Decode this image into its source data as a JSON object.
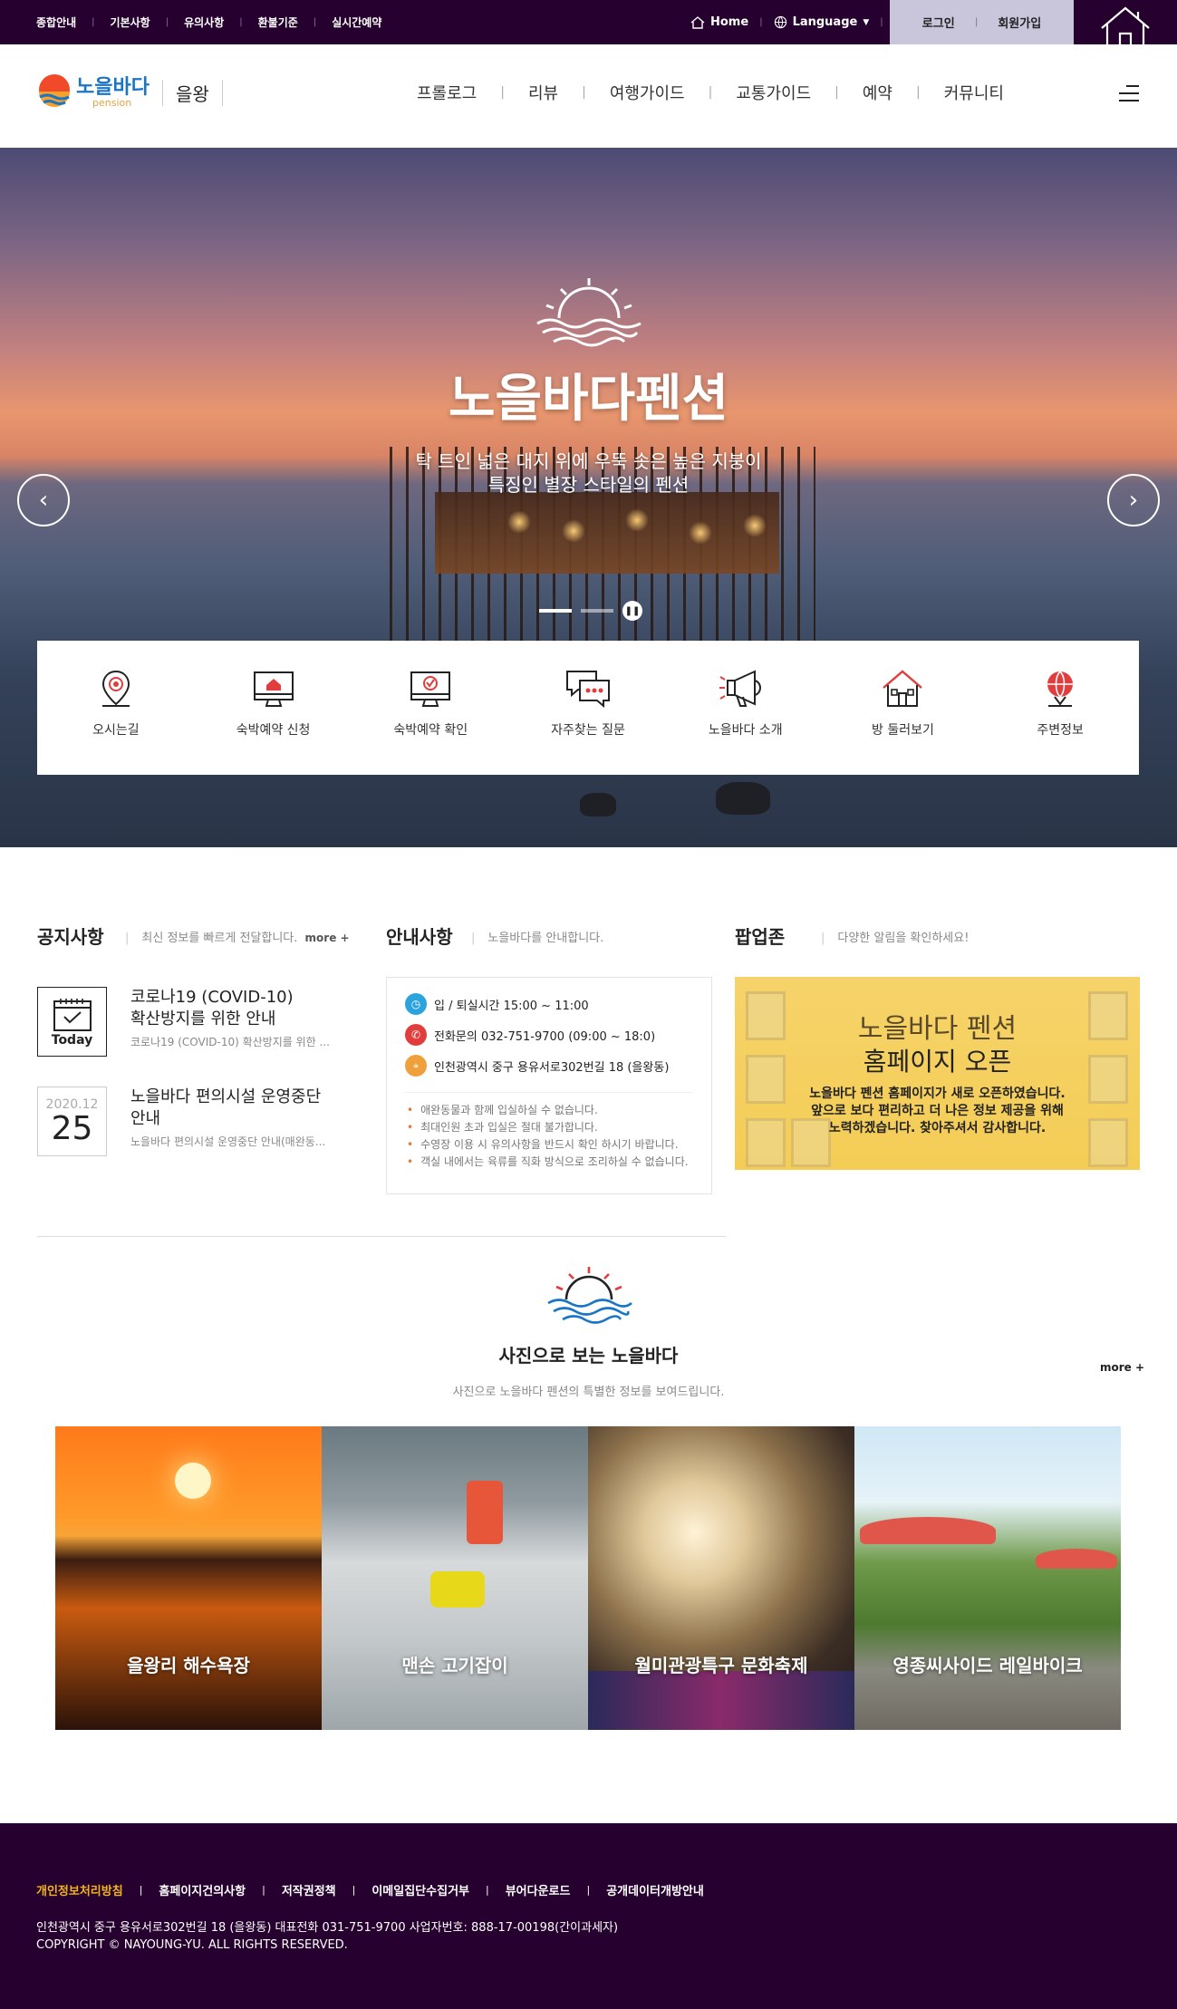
{
  "topbar": {
    "util_links": [
      "종합안내",
      "기본사항",
      "유의사항",
      "환불기준",
      "실시간예약"
    ],
    "home": "Home",
    "language": "Language",
    "login": "로그인",
    "signup": "회원가입"
  },
  "header": {
    "logo_main": "노을바다",
    "logo_sub": "pension",
    "region": "을왕",
    "menu": [
      "프롤로그",
      "리뷰",
      "여행가이드",
      "교통가이드",
      "예약",
      "커뮤니티"
    ]
  },
  "hero": {
    "title": "노을바다펜션",
    "subtitle_line1": "탁 트인 넓은 대지 위에  우뚝 솟은 높은 지붕이",
    "subtitle_line2": "특징인 별장 스타일의 펜션",
    "prev": "‹",
    "next": "›"
  },
  "quick_menu": [
    {
      "label": "오시는길",
      "icon": "map-pin-icon"
    },
    {
      "label": "숙박예약 신청",
      "icon": "monitor-house-icon"
    },
    {
      "label": "숙박예약 확인",
      "icon": "monitor-check-icon"
    },
    {
      "label": "자주찾는 질문",
      "icon": "chat-bubbles-icon"
    },
    {
      "label": "노을바다 소개",
      "icon": "megaphone-icon"
    },
    {
      "label": "방 둘러보기",
      "icon": "house-icon"
    },
    {
      "label": "주변정보",
      "icon": "location-globe-icon"
    }
  ],
  "notice": {
    "title": "공지사항",
    "desc": "최신 정보를 빠르게 전달합니다.",
    "more": "more +",
    "items": [
      {
        "badge_label": "Today",
        "title_line1": "코로나19 (COVID-10)",
        "title_line2": "확산방지를 위한 안내",
        "summary": "코로나19 (COVID-10) 확산방지를 위한 ..."
      },
      {
        "date_year": "2020.12",
        "date_day": "25",
        "title_line1": "노을바다 편의시설 운영중단",
        "title_line2": "안내",
        "summary": "노을바다 편의시설 운영중단 안내(매완동..."
      }
    ]
  },
  "guide": {
    "title": "안내사항",
    "desc": "노을바다를 안내합니다.",
    "checkin": "입 / 퇴실시간 15:00 ~ 11:00",
    "phone": "전화문의 032-751-9700 (09:00 ~ 18:0)",
    "address": "인천광역시 중구 용유서로302번길 18 (을왕동)",
    "notes": [
      "애완동물과 함께 입실하실 수 없습니다.",
      "최대인원 초과 입실은 절대 불가합니다.",
      "수영장 이용 시 유의사항을 반드시 확인 하시기 바랍니다.",
      "객실 내에서는 육류를 직화 방식으로 조리하실 수 없습니다."
    ]
  },
  "popup": {
    "title": "팝업존",
    "desc": "다양한 알림을 확인하세요!",
    "banner_line1": "노을바다 펜션",
    "banner_line2": "홈페이지 오픈",
    "banner_desc1": "노을바다 펜션 홈페이지가 새로 오픈하였습니다.",
    "banner_desc2": "앞으로 보다 편리하고 더 나은 정보 제공을 위해",
    "banner_desc3": "노력하겠습니다. 찾아주셔서 감사합니다."
  },
  "gallery": {
    "title": "사진으로 보는 노을바다",
    "desc": "사진으로 노을바다 펜션의 특별한 정보를 보여드립니다.",
    "more": "more +",
    "items": [
      "을왕리 해수욕장",
      "맨손 고기잡이",
      "월미관광특구 문화축제",
      "영종씨사이드 레일바이크"
    ]
  },
  "footer": {
    "links": [
      "개인정보처리방침",
      "홈페이지건의사항",
      "저작권정책",
      "이메일집단수집거부",
      "뷰어다운로드",
      "공개데이터개방안내"
    ],
    "address": "인천광역시 중구 용유서로302번길 18 (을왕동) 대표전화 031-751-9700 사업자번호: 888-17-00198(간이과세자)",
    "copyright": "COPYRIGHT © NAYOUNG-YU. ALL RIGHTS RESERVED."
  },
  "colors": {
    "brand_dark": "#26002e",
    "accent_orange": "#e8763a",
    "accent_red": "#e23d3d",
    "auth_bg": "#c9c6dc",
    "popup_yellow": "#f4cd55",
    "footer_highlight": "#f1b51a"
  }
}
